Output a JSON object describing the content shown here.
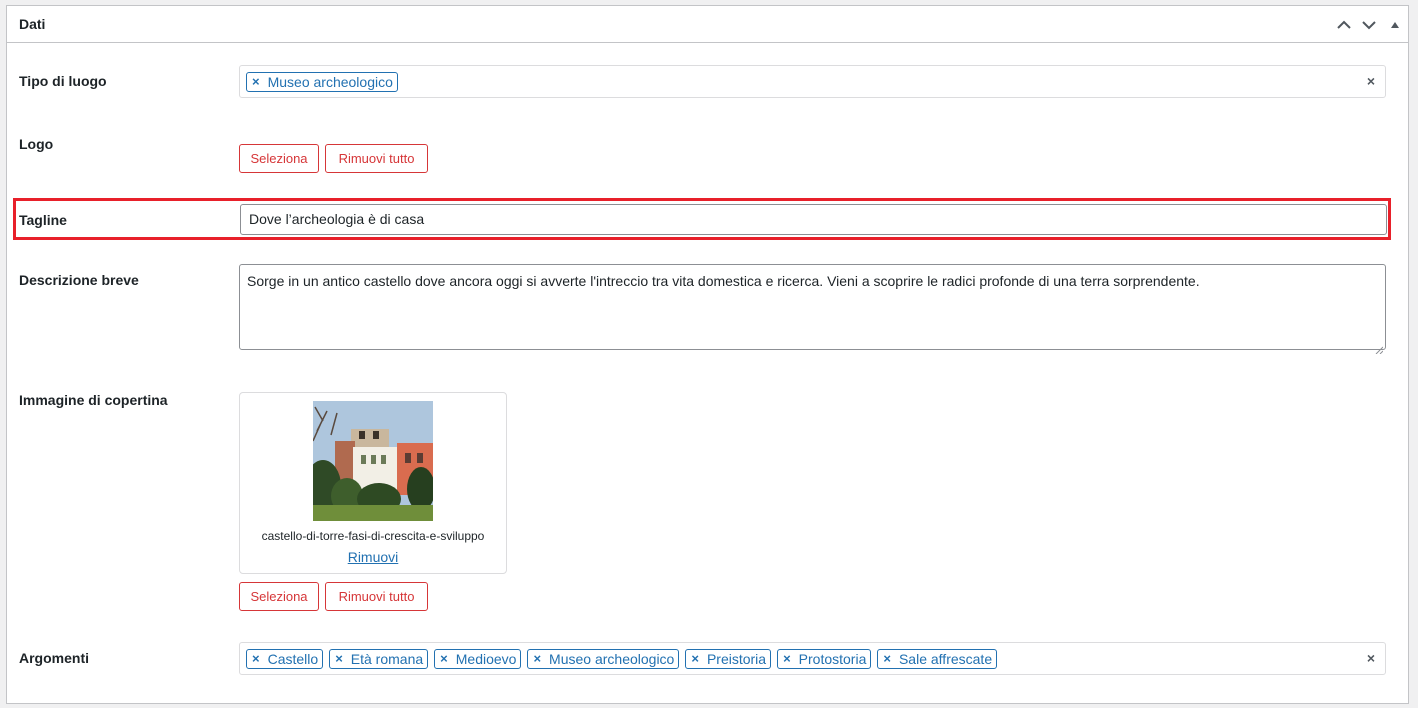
{
  "panel": {
    "title": "Dati",
    "controls": {
      "move_up": "chevron-up-icon",
      "move_down": "chevron-down-icon",
      "toggle": "caret-up-icon"
    }
  },
  "tipo_di_luogo": {
    "label": "Tipo di luogo",
    "selected": [
      "Museo archeologico"
    ],
    "chip_remove": "×",
    "clear": "×"
  },
  "logo": {
    "label": "Logo",
    "select_button": "Seleziona",
    "remove_all_button": "Rimuovi tutto"
  },
  "tagline": {
    "label": "Tagline",
    "value": "Dove l’archeologia è di casa"
  },
  "descrizione": {
    "label": "Descrizione breve",
    "value": "Sorge in un antico castello dove ancora oggi si avverte l'intreccio tra vita domestica e ricerca. Vieni a scoprire le radici profonde di una terra sorprendente."
  },
  "copertina": {
    "label": "Immagine di copertina",
    "filename": "castello-di-torre-fasi-di-crescita-e-sviluppo",
    "remove_link": "Rimuovi",
    "select_button": "Seleziona",
    "remove_all_button": "Rimuovi tutto"
  },
  "argomenti": {
    "label": "Argomenti",
    "selected": [
      "Castello",
      "Età romana",
      "Medioevo",
      "Museo archeologico",
      "Preistoria",
      "Protostoria",
      "Sale affrescate"
    ],
    "chip_remove": "×",
    "clear": "×"
  },
  "colors": {
    "accent": "#2271b1",
    "danger": "#d63638",
    "highlight": "#e8202a"
  }
}
